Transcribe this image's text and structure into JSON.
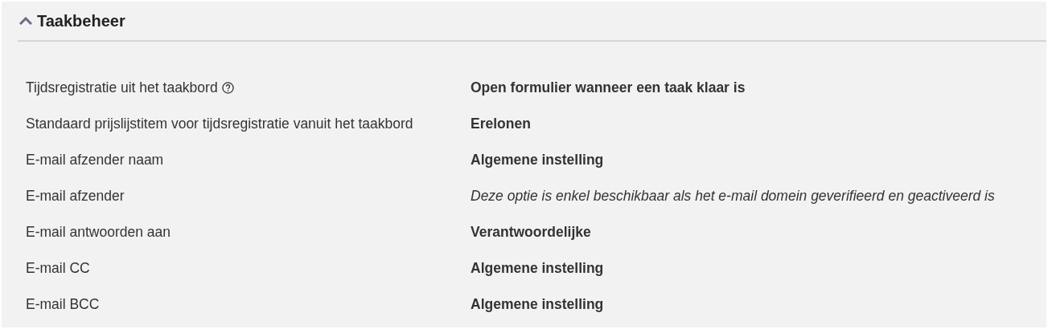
{
  "section": {
    "title": "Taakbeheer",
    "expanded": true
  },
  "rows": [
    {
      "label": "Tijdsregistratie uit het taakbord",
      "help": true,
      "value": "Open formulier wanneer een taak klaar is",
      "kind": "setting"
    },
    {
      "label": "Standaard prijslijstitem voor tijdsregistratie vanuit het taakbord",
      "help": false,
      "value": "Erelonen",
      "kind": "setting"
    },
    {
      "label": "E-mail afzender naam",
      "help": false,
      "value": "Algemene instelling",
      "kind": "setting"
    },
    {
      "label": "E-mail afzender",
      "help": false,
      "value": "Deze optie is enkel beschikbaar als het e-mail domein geverifieerd en geactiveerd is",
      "kind": "note"
    },
    {
      "label": "E-mail antwoorden aan",
      "help": false,
      "value": "Verantwoordelijke",
      "kind": "setting"
    },
    {
      "label": "E-mail CC",
      "help": false,
      "value": "Algemene instelling",
      "kind": "setting"
    },
    {
      "label": "E-mail BCC",
      "help": false,
      "value": "Algemene instelling",
      "kind": "setting"
    }
  ]
}
